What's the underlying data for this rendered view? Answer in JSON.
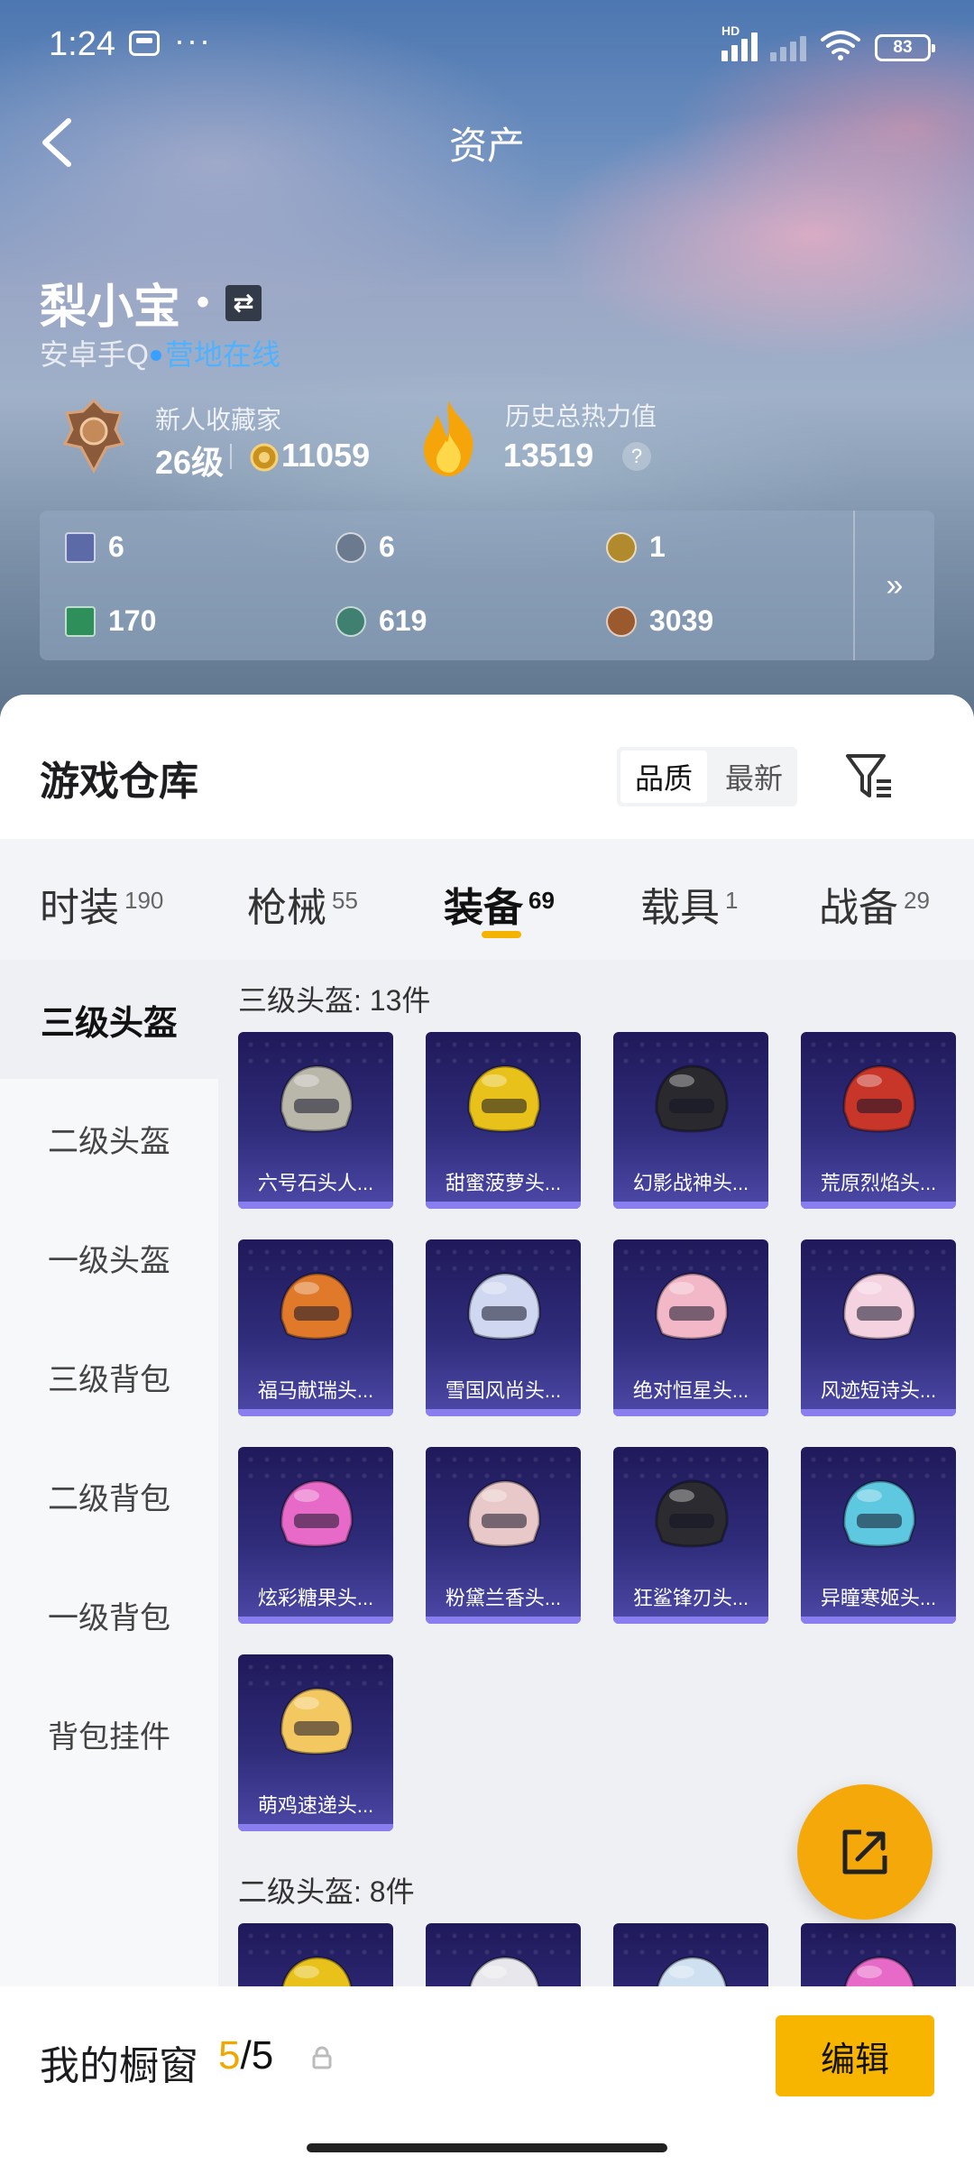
{
  "status_bar": {
    "time": "1:24",
    "battery": "83",
    "network": "HD"
  },
  "header": {
    "title": "资产"
  },
  "profile": {
    "name": "梨小宝",
    "separator": "•",
    "account": "安卓手Q",
    "online_status": "营地在线",
    "collector_title": "新人收藏家",
    "level": "26级",
    "coins": "11059",
    "heat_label": "历史总热力值",
    "heat_value": "13519",
    "help": "?"
  },
  "currencies": [
    {
      "value": "6",
      "icon": "card-icon",
      "color": "#5d6aa8"
    },
    {
      "value": "6",
      "icon": "token-gray-icon",
      "color": "#6b7a8e"
    },
    {
      "value": "1",
      "icon": "token-gold-icon",
      "color": "#b28a2e"
    },
    {
      "value": "170",
      "icon": "ticket-green-icon",
      "color": "#2e8f5a"
    },
    {
      "value": "619",
      "icon": "token-green-icon",
      "color": "#3f8070"
    },
    {
      "value": "3039",
      "icon": "token-copper-icon",
      "color": "#9a5a2e"
    }
  ],
  "currency_more": "»",
  "warehouse": {
    "title": "游戏仓库",
    "sort": [
      "品质",
      "最新"
    ]
  },
  "tabs": [
    {
      "label": "时装",
      "count": "190"
    },
    {
      "label": "枪械",
      "count": "55"
    },
    {
      "label": "装备",
      "count": "69"
    },
    {
      "label": "载具",
      "count": "1"
    },
    {
      "label": "战备",
      "count": "29"
    }
  ],
  "categories": [
    "三级头盔",
    "二级头盔",
    "一级头盔",
    "三级背包",
    "二级背包",
    "一级背包",
    "背包挂件"
  ],
  "sections": [
    {
      "title": "三级头盔: 13件",
      "items": [
        {
          "name": "六号石头人...",
          "color": "#b9b6aa"
        },
        {
          "name": "甜蜜菠萝头...",
          "color": "#e8c21a"
        },
        {
          "name": "幻影战神头...",
          "color": "#2a2a2e"
        },
        {
          "name": "荒原烈焰头...",
          "color": "#c8362a"
        },
        {
          "name": "福马献瑞头...",
          "color": "#e07a2a"
        },
        {
          "name": "雪国风尚头...",
          "color": "#cfd8f0"
        },
        {
          "name": "绝对恒星头...",
          "color": "#f2b8c8"
        },
        {
          "name": "风迹短诗头...",
          "color": "#f4d2e0"
        },
        {
          "name": "炫彩糖果头...",
          "color": "#e86ac8"
        },
        {
          "name": "粉黛兰香头...",
          "color": "#e8c8c8"
        },
        {
          "name": "狂鲨锋刃头...",
          "color": "#2c2c30"
        },
        {
          "name": "异瞳寒姬头...",
          "color": "#5ec8e0"
        },
        {
          "name": "萌鸡速递头...",
          "color": "#f4c860"
        }
      ]
    },
    {
      "title": "二级头盔: 8件",
      "items": [
        {
          "name": "",
          "color": "#e8c21a"
        },
        {
          "name": "",
          "color": "#e8e8ec"
        },
        {
          "name": "",
          "color": "#cfe0f0"
        },
        {
          "name": "",
          "color": "#e86ac8"
        }
      ]
    }
  ],
  "bottom": {
    "showcase_label": "我的橱窗",
    "current": "5",
    "total": "/5",
    "edit": "编辑"
  }
}
